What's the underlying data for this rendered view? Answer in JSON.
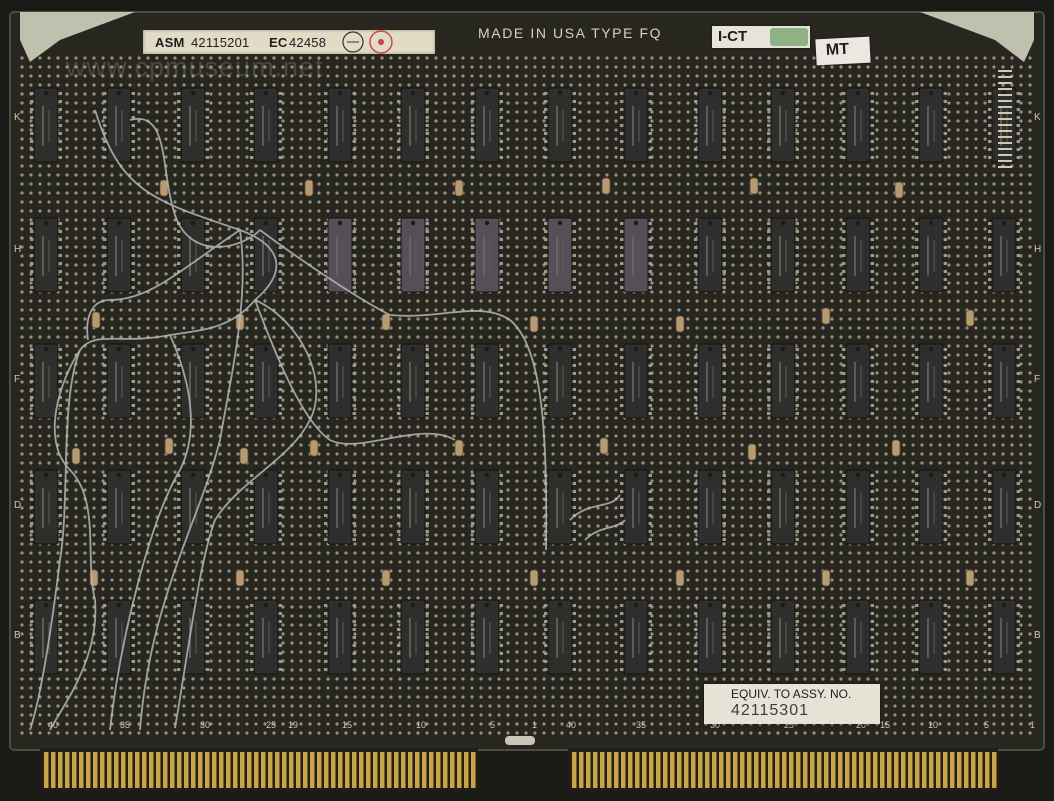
{
  "photo": {
    "subject": "printed circuit board",
    "colors": {
      "background": "#1a1a17",
      "board": "#27261f",
      "board_edge": "#4d4c42",
      "dot": "#c5c0a6",
      "chip": "#2e2e2c",
      "chip_purple": "#564f58",
      "wire": "#b5b8b6",
      "gold": "#c9a542",
      "resistor": "#b79a70",
      "corner_tab": "#bfc0ae"
    }
  },
  "labels": {
    "asm_prefix": "ASM",
    "asm_number": "42115201",
    "ec_prefix": "EC",
    "ec_number": "42458",
    "made_in": "MADE IN USA TYPE FQ",
    "ict": "I-CT",
    "mt": "MT",
    "equiv_title": "EQUIV. TO ASSY. NO.",
    "equiv_number": "42115301",
    "watermark": "www.cpmuseum.net"
  },
  "silkscreen": {
    "row_letters": [
      "K",
      "H",
      "F",
      "D",
      "B"
    ],
    "col_numbers": [
      "40",
      "35",
      "30",
      "25",
      "19",
      "15",
      "10",
      "5",
      "1",
      "40",
      "35",
      "30",
      "25",
      "20",
      "15",
      "10",
      "5",
      "1"
    ]
  }
}
